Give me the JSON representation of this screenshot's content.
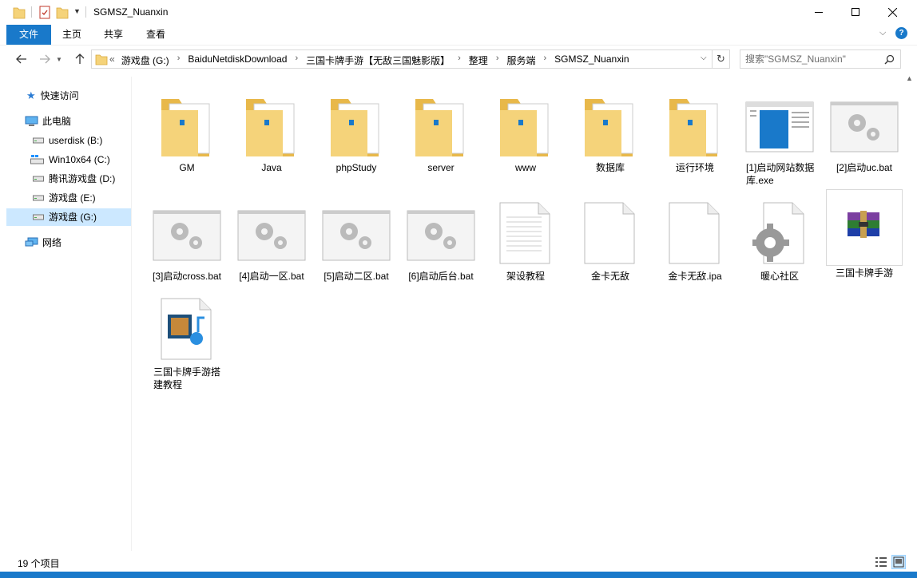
{
  "window": {
    "title": "SGMSZ_Nuanxin",
    "minimize_glyph": "—",
    "maximize_glyph": "☐",
    "close_glyph": "✕"
  },
  "ribbon": {
    "tabs": [
      "文件",
      "主页",
      "共享",
      "查看"
    ]
  },
  "nav": {
    "path_prefix": "«",
    "breadcrumbs": [
      "游戏盘 (G:)",
      "BaiduNetdiskDownload",
      "三国卡牌手游【无敌三国魅影版】",
      "整理",
      "服务端",
      "SGMSZ_Nuanxin"
    ],
    "search_placeholder": "搜索\"SGMSZ_Nuanxin\""
  },
  "sidebar": {
    "items": [
      {
        "label": "快速访问",
        "icon": "star-icon"
      },
      {
        "label": "此电脑",
        "icon": "computer-icon"
      },
      {
        "label": "userdisk (B:)",
        "icon": "drive-icon"
      },
      {
        "label": "Win10x64 (C:)",
        "icon": "windows-drive-icon"
      },
      {
        "label": "腾讯游戏盘 (D:)",
        "icon": "drive-icon"
      },
      {
        "label": "游戏盘 (E:)",
        "icon": "drive-icon"
      },
      {
        "label": "游戏盘 (G:)",
        "icon": "drive-icon"
      },
      {
        "label": "网络",
        "icon": "network-icon"
      }
    ]
  },
  "files": [
    {
      "name": "GM",
      "type": "folder"
    },
    {
      "name": "Java",
      "type": "folder"
    },
    {
      "name": "phpStudy",
      "type": "folder"
    },
    {
      "name": "server",
      "type": "folder"
    },
    {
      "name": "www",
      "type": "folder"
    },
    {
      "name": "数据库",
      "type": "folder"
    },
    {
      "name": "运行环境",
      "type": "folder"
    },
    {
      "name": "[1]启动网站数据库.exe",
      "type": "exe"
    },
    {
      "name": "[2]启动uc.bat",
      "type": "bat"
    },
    {
      "name": "[3]启动cross.bat",
      "type": "bat"
    },
    {
      "name": "[4]启动一区.bat",
      "type": "bat"
    },
    {
      "name": "[5]启动二区.bat",
      "type": "bat"
    },
    {
      "name": "[6]启动后台.bat",
      "type": "bat"
    },
    {
      "name": "架设教程",
      "type": "text"
    },
    {
      "name": "金卡无敌",
      "type": "blank"
    },
    {
      "name": "金卡无敌.ipa",
      "type": "blank"
    },
    {
      "name": "暖心社区",
      "type": "settings"
    },
    {
      "name": "三国卡牌手游",
      "type": "rar"
    },
    {
      "name": "三国卡牌手游搭建教程",
      "type": "video"
    }
  ],
  "status": {
    "item_count": "19 个项目"
  },
  "colors": {
    "accent": "#1979ca",
    "selected": "#cce8ff",
    "folder": "#f5d37a"
  }
}
